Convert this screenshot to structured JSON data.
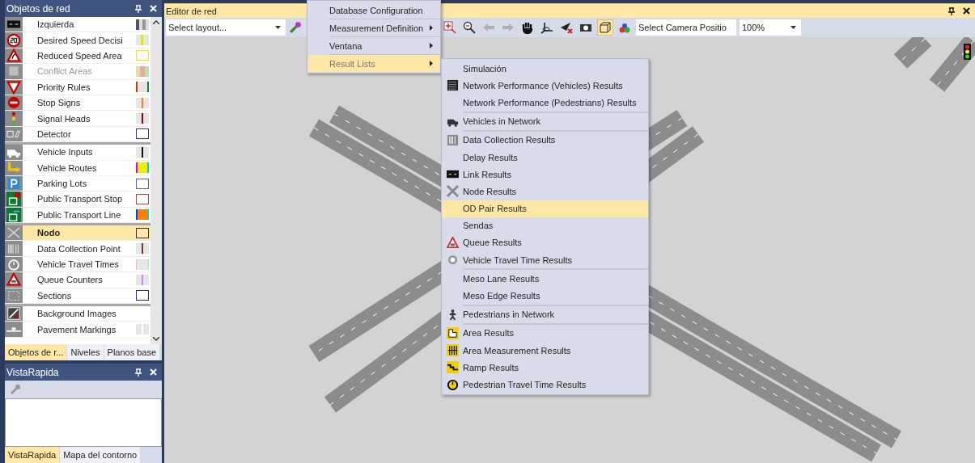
{
  "object_panel": {
    "title": "Objetos de red",
    "groups": [
      [
        {
          "label": "Izquierda",
          "selected": false,
          "disabled": false
        },
        {
          "label": "Desired Speed Decisi",
          "selected": false,
          "disabled": false
        },
        {
          "label": "Reduced Speed Area",
          "selected": false,
          "disabled": false
        },
        {
          "label": "Conflict Areas",
          "selected": false,
          "disabled": true
        },
        {
          "label": "Priority Rules",
          "selected": false,
          "disabled": false
        },
        {
          "label": "Stop Signs",
          "selected": false,
          "disabled": false
        },
        {
          "label": "Signal Heads",
          "selected": false,
          "disabled": false
        },
        {
          "label": "Detector",
          "selected": false,
          "disabled": false
        }
      ],
      [
        {
          "label": "Vehicle Inputs",
          "selected": false,
          "disabled": false
        },
        {
          "label": "Vehicle Routes",
          "selected": false,
          "disabled": false
        },
        {
          "label": "Parking Lots",
          "selected": false,
          "disabled": false
        },
        {
          "label": "Public Transport Stop",
          "selected": false,
          "disabled": false
        },
        {
          "label": "Public Transport Line",
          "selected": false,
          "disabled": false
        }
      ],
      [
        {
          "label": "Nodo",
          "selected": true,
          "disabled": false
        },
        {
          "label": "Data Collection Point",
          "selected": false,
          "disabled": false
        },
        {
          "label": "Vehicle Travel Times",
          "selected": false,
          "disabled": false
        },
        {
          "label": "Queue Counters",
          "selected": false,
          "disabled": false
        },
        {
          "label": "Sections",
          "selected": false,
          "disabled": false
        }
      ],
      [
        {
          "label": "Background Images",
          "selected": false,
          "disabled": false
        },
        {
          "label": "Pavement Markings",
          "selected": false,
          "disabled": false
        }
      ]
    ],
    "tabs": [
      {
        "label": "Objetos de r...",
        "selected": true
      },
      {
        "label": "Niveles",
        "selected": false
      },
      {
        "label": "Planos base",
        "selected": false
      }
    ]
  },
  "quick_view": {
    "title": "VistaRapida",
    "tabs": [
      {
        "label": "VistaRapida",
        "selected": true
      },
      {
        "label": "Mapa del contorno",
        "selected": false
      }
    ]
  },
  "editor": {
    "title": "Editor de red",
    "layout_select": {
      "value": "Select layout..."
    },
    "box_view_selected": true,
    "camera_select": {
      "value": "Select Camera Positio"
    },
    "zoom_select": {
      "value": "100%"
    }
  },
  "menu": {
    "items": [
      {
        "label": "Database Configuration",
        "has_submenu": false,
        "selected": false
      },
      {
        "label": "Measurement Definition",
        "has_submenu": true,
        "selected": false
      },
      {
        "label": "Ventana",
        "has_submenu": true,
        "selected": false
      },
      {
        "label": "Result Lists",
        "has_submenu": true,
        "selected": true
      }
    ]
  },
  "submenu": {
    "groups": [
      [
        {
          "label": "Simulación",
          "selected": false
        },
        {
          "label": "Network Performance (Vehicles) Results",
          "selected": false
        },
        {
          "label": "Network Performance (Pedestrians) Results",
          "selected": false
        }
      ],
      [
        {
          "label": "Vehicles in Network",
          "selected": false
        }
      ],
      [
        {
          "label": "Data Collection Results",
          "selected": false
        },
        {
          "label": "Delay Results",
          "selected": false
        },
        {
          "label": "Link Results",
          "selected": false
        },
        {
          "label": "Node Results",
          "selected": false
        },
        {
          "label": "OD Pair Results",
          "selected": true
        },
        {
          "label": "Sendas",
          "selected": false
        },
        {
          "label": "Queue Results",
          "selected": false
        },
        {
          "label": "Vehicle Travel Time Results",
          "selected": false
        }
      ],
      [
        {
          "label": "Meso Lane Results",
          "selected": false
        },
        {
          "label": "Meso Edge Results",
          "selected": false
        }
      ],
      [
        {
          "label": "Pedestrians in Network",
          "selected": false
        }
      ],
      [
        {
          "label": "Area Results",
          "selected": false
        },
        {
          "label": "Area Measurement Results",
          "selected": false
        },
        {
          "label": "Ramp Results",
          "selected": false
        },
        {
          "label": "Pedestrian Travel Time Results",
          "selected": false
        }
      ]
    ]
  }
}
